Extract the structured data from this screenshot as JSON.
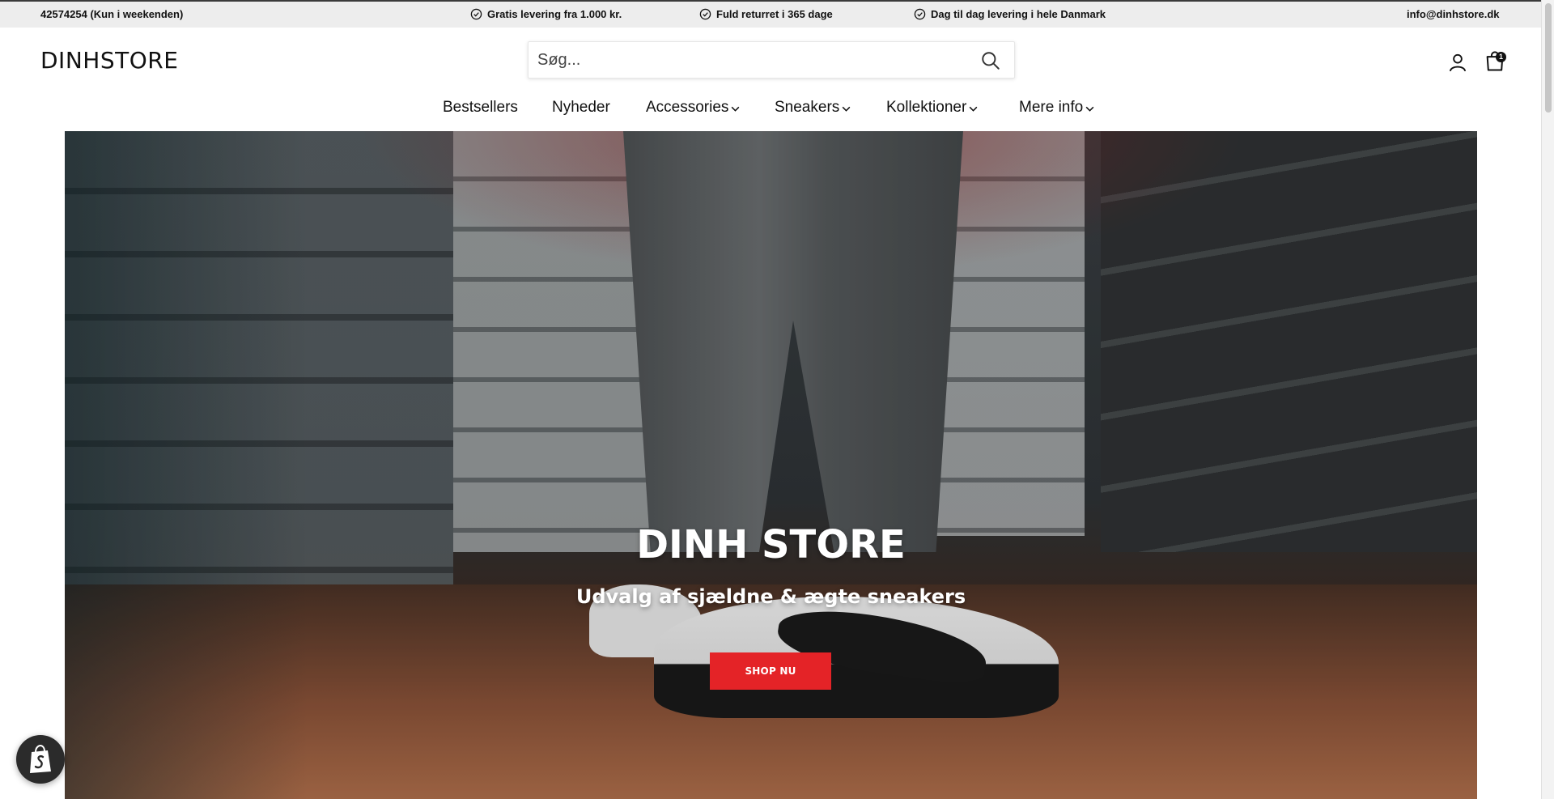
{
  "announcement": {
    "phone": "42574254 (Kun i weekenden)",
    "perks": [
      {
        "icon": "check-circle-icon",
        "text": "Gratis levering fra 1.000 kr."
      },
      {
        "icon": "check-circle-icon",
        "text": "Fuld returret i 365 dage"
      },
      {
        "icon": "check-circle-icon",
        "text": "Dag til dag levering i hele Danmark"
      }
    ],
    "email": "info@dinhstore.dk"
  },
  "header": {
    "logo": "DINHSTORE",
    "search_placeholder": "Søg...",
    "cart_count": "1"
  },
  "nav": {
    "items": [
      {
        "label": "Bestsellers",
        "dropdown": false
      },
      {
        "label": "Nyheder",
        "dropdown": false
      },
      {
        "label": "Accessories",
        "dropdown": true
      },
      {
        "label": "Sneakers",
        "dropdown": true
      },
      {
        "label": "Kollektioner",
        "dropdown": true
      },
      {
        "label": "Mere info",
        "dropdown": true
      }
    ]
  },
  "hero": {
    "title": "DINH STORE",
    "subtitle": "Udvalg af sjældne & ægte sneakers",
    "cta_label": "SHOP NU"
  },
  "colors": {
    "cta": "#e42327",
    "topbar_bg": "#ededed"
  }
}
